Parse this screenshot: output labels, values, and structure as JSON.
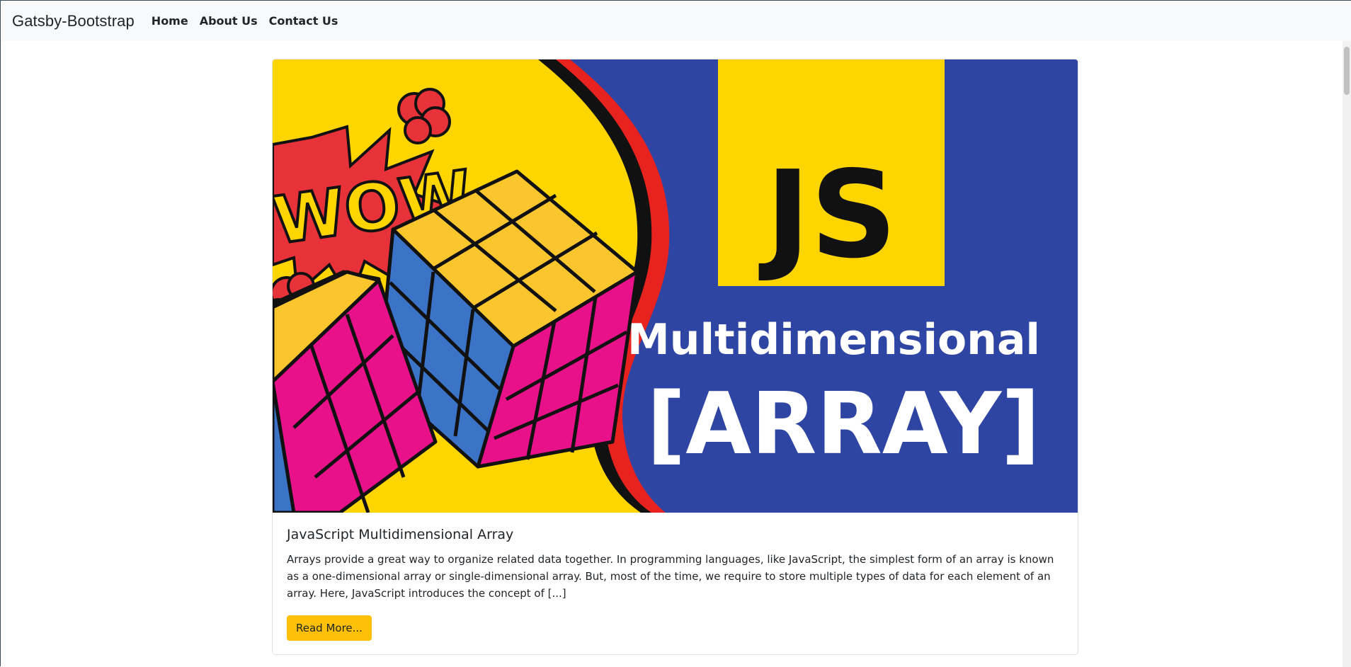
{
  "navbar": {
    "brand": "Gatsby-Bootstrap",
    "links": [
      "Home",
      "About Us",
      "Contact Us"
    ],
    "background": "#f8f9fa"
  },
  "post": {
    "image": {
      "headline_top": "JS",
      "headline_mid": "Multidimensional",
      "headline_bottom": "[ARRAY]",
      "comic_text": "WOW",
      "colors": {
        "yellow": "#ffd500",
        "blue": "#2e45a3",
        "magenta": "#e8118a",
        "red": "#e8323a",
        "cube_blue": "#3b73c7"
      }
    },
    "title": "JavaScript Multidimensional Array",
    "excerpt": "Arrays provide a great way to organize related data together. In programming languages, like JavaScript, the simplest form of an array is known as a one-dimensional array or single-dimensional array. But, most of the time, we require to store multiple types of data for each element of an array. Here, JavaScript introduces the concept of [...]",
    "button_label": "Read More...",
    "button_color": "#ffc107"
  }
}
